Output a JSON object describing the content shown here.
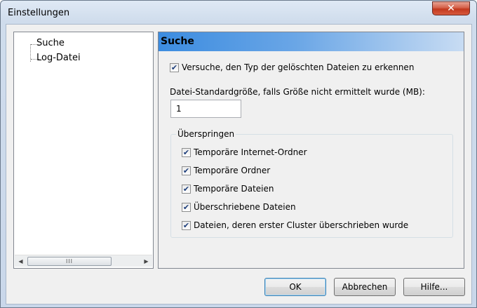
{
  "window": {
    "title": "Einstellungen",
    "close_symbol": "✕"
  },
  "tree": {
    "items": [
      {
        "label": "Suche"
      },
      {
        "label": "Log-Datei"
      }
    ],
    "scrollbar": {
      "left_arrow": "◀",
      "right_arrow": "▶",
      "thumb_grip": "III"
    }
  },
  "panel": {
    "header": "Suche",
    "detect_type": {
      "label": "Versuche, den Typ der gelöschten Dateien zu erkennen",
      "checked": true
    },
    "default_size": {
      "label": "Datei-Standardgröße, falls Größe nicht ermittelt wurde (MB):",
      "value": "1"
    },
    "skip": {
      "legend": "Überspringen",
      "options": [
        {
          "label": "Temporäre Internet-Ordner",
          "checked": true
        },
        {
          "label": "Temporäre Ordner",
          "checked": true
        },
        {
          "label": "Temporäre Dateien",
          "checked": true
        },
        {
          "label": "Überschriebene Dateien",
          "checked": true
        },
        {
          "label": "Dateien, deren erster Cluster überschrieben wurde",
          "checked": true
        }
      ]
    },
    "check_symbol": "✔"
  },
  "buttons": {
    "ok": "OK",
    "cancel": "Abbrechen",
    "help": "Hilfe..."
  },
  "colors": {
    "header_gradient_start": "#3c8ce0",
    "close_button": "#c2381d"
  }
}
